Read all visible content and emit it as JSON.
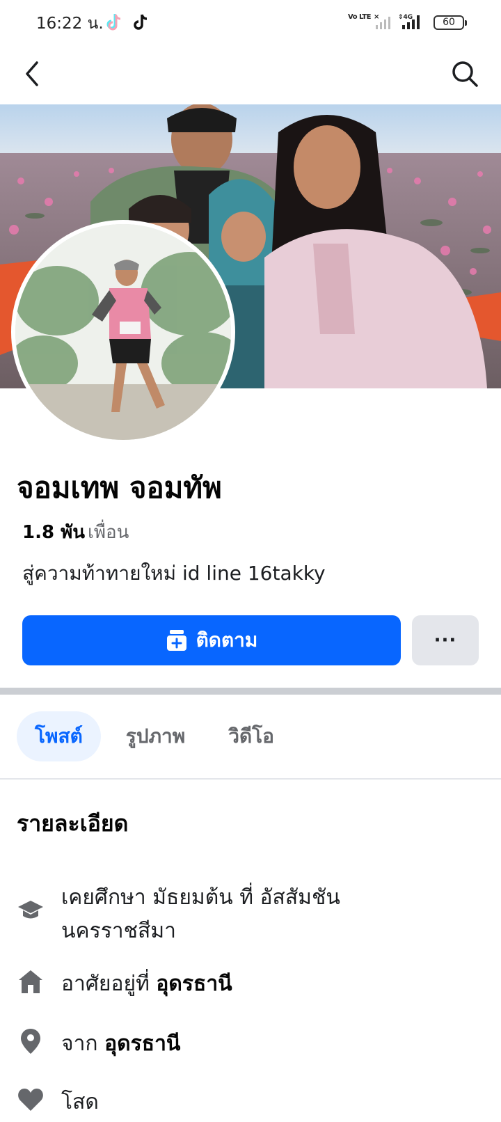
{
  "status_bar": {
    "time": "16:22 น.",
    "volte_label": "Vo LTE",
    "battery": "60"
  },
  "nav": {
    "back_icon": "chevron-left-icon",
    "search_icon": "search-icon"
  },
  "profile": {
    "name": "จอมเทพ จอมทัพ",
    "friends_count": "1.8 พัน",
    "friends_label": "เพื่อน",
    "bio": "สู่ความท้าทายใหม่ id line 16takky"
  },
  "actions": {
    "follow_label": "ติดตาม",
    "more_label": "···"
  },
  "tabs": [
    {
      "label": "โพสต์",
      "active": true
    },
    {
      "label": "รูปภาพ",
      "active": false
    },
    {
      "label": "วิดีโอ",
      "active": false
    }
  ],
  "details": {
    "title": "รายละเอียด",
    "education_text": "เคยศึกษา มัธยมต้น ที่ อัสสัมชัน นครราชสีมา",
    "lives_prefix": "อาศัยอยู่ที่",
    "lives_place": "อุดรธานี",
    "from_prefix": "จาก",
    "from_place": "อุดรธานี",
    "relationship": "โสด"
  },
  "colors": {
    "accent": "#0866ff",
    "tab_active_bg": "#ebf3ff",
    "icon_gray": "#65676b"
  }
}
